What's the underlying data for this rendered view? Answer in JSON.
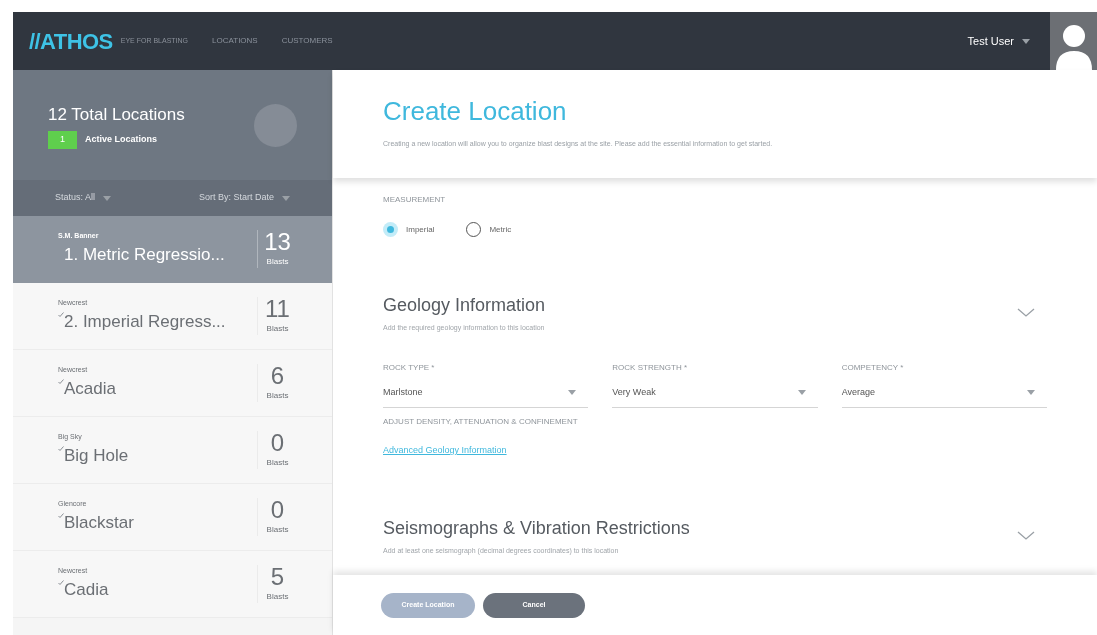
{
  "top_bar": {
    "logo": "//ATHOS",
    "tagline": "EYE FOR BLASTING",
    "nav": [
      {
        "label": "LOCATIONS",
        "selected": false
      },
      {
        "label": "CUSTOMERS",
        "selected": false
      }
    ],
    "user": "Test User"
  },
  "sidebar": {
    "total": "12 Total Locations",
    "active_count": "1",
    "active_label": "Active Locations",
    "filters": [
      {
        "label": "Status:",
        "value": "All"
      },
      {
        "label": "Sort By:",
        "value": "Start Date"
      }
    ],
    "items": [
      {
        "customer": "S.M. Banner",
        "name": "1. Metric Regressio...",
        "count": "13",
        "unit": "Blasts",
        "selected": true,
        "checked": false
      },
      {
        "customer": "Newcrest",
        "name": "2. Imperial Regress...",
        "count": "11",
        "unit": "Blasts",
        "selected": false,
        "checked": true
      },
      {
        "customer": "Newcrest",
        "name": "Acadia",
        "count": "6",
        "unit": "Blasts",
        "selected": false,
        "checked": true
      },
      {
        "customer": "Big Sky",
        "name": "Big Hole",
        "count": "0",
        "unit": "Blasts",
        "selected": false,
        "checked": true
      },
      {
        "customer": "Glencore",
        "name": "Blackstar",
        "count": "0",
        "unit": "Blasts",
        "selected": false,
        "checked": true
      },
      {
        "customer": "Newcrest",
        "name": "Cadia",
        "count": "5",
        "unit": "Blasts",
        "selected": false,
        "checked": true
      }
    ]
  },
  "header": {
    "title": "Create Location",
    "subtitle": "Creating a new location will allow you to organize blast designs at the site. Please add the essential information to get started."
  },
  "measurement": {
    "label": "MEASUREMENT",
    "options": [
      {
        "label": "Imperial",
        "selected": true
      },
      {
        "label": "Metric",
        "selected": false
      }
    ]
  },
  "sections": [
    {
      "title": "Geology Information",
      "subtitle": "Add the required geology information to this location",
      "fields": [
        {
          "label": "ROCK TYPE *",
          "value": "Marlstone"
        },
        {
          "label": "ROCK STRENGTH *",
          "value": "Very Weak"
        },
        {
          "label": "COMPETENCY *",
          "value": "Average"
        }
      ],
      "adjust_label": "ADJUST DENSITY, ATTENUATION & CONFINEMENT",
      "link": "Advanced Geology Information"
    },
    {
      "title": "Seismographs & Vibration Restrictions",
      "subtitle": "Add at least one seismograph (decimal degrees coordinates) to this location"
    }
  ],
  "buttons": [
    {
      "label": "Create Location",
      "disabled": true
    },
    {
      "label": "Cancel",
      "disabled": false
    }
  ]
}
